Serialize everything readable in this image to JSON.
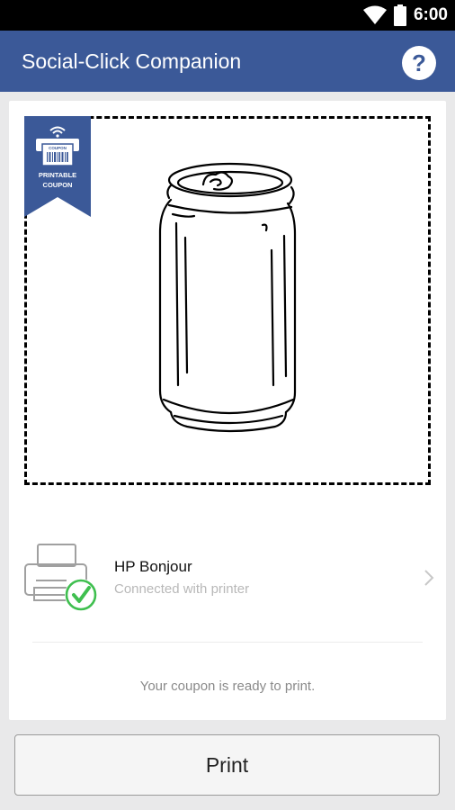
{
  "status_bar": {
    "time": "6:00",
    "icons": [
      "wifi-icon",
      "battery-icon"
    ]
  },
  "app_bar": {
    "title": "Social-Click Companion",
    "help_icon": "help-circle-icon",
    "color": "#3b5998"
  },
  "coupon": {
    "ribbon_label_line1": "PRINTABLE",
    "ribbon_label_line2": "COUPON",
    "ribbon_small_label": "COUPON",
    "ribbon_color": "#3b5998",
    "image": "soda-can-illustration"
  },
  "printer": {
    "name": "HP Bonjour",
    "status": "Connected with printer",
    "icon": "printer-icon",
    "check_icon": "check-circle-icon",
    "check_color": "#3fbf4f"
  },
  "message": "Your coupon is ready to print.",
  "print_button": {
    "label": "Print"
  }
}
